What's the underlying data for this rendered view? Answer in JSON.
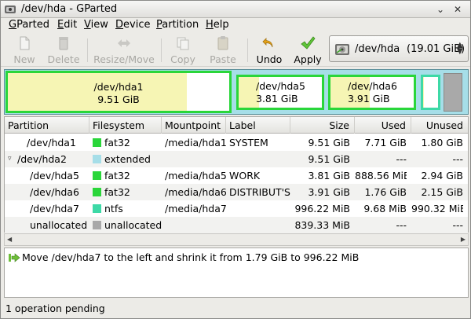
{
  "window": {
    "title": "/dev/hda - GParted",
    "minimize_icon": "chevron-down-icon",
    "close_icon": "close-icon"
  },
  "menubar": {
    "items": [
      {
        "label": "GParted",
        "mnemonic": "G"
      },
      {
        "label": "Edit",
        "mnemonic": "E"
      },
      {
        "label": "View",
        "mnemonic": "V"
      },
      {
        "label": "Device",
        "mnemonic": "D"
      },
      {
        "label": "Partition",
        "mnemonic": "P"
      },
      {
        "label": "Help",
        "mnemonic": "H"
      }
    ]
  },
  "toolbar": {
    "new_label": "New",
    "delete_label": "Delete",
    "resize_label": "Resize/Move",
    "copy_label": "Copy",
    "paste_label": "Paste",
    "undo_label": "Undo",
    "apply_label": "Apply"
  },
  "device": {
    "name": "/dev/hda",
    "size": "(19.01 GiB)"
  },
  "partition_map": [
    {
      "name": "/dev/hda1",
      "size": "9.51 GiB"
    },
    {
      "name": "/dev/hda5",
      "size": "3.81 GiB"
    },
    {
      "name": "/dev/hda6",
      "size": "3.91 GiB"
    }
  ],
  "table": {
    "columns": [
      "Partition",
      "Filesystem",
      "Mountpoint",
      "Label",
      "Size",
      "Used",
      "Unused"
    ],
    "rows": [
      {
        "partition": "/dev/hda1",
        "filesystem": "fat32",
        "mountpoint": "/media/hda1",
        "label": "SYSTEM",
        "size": "9.51 GiB",
        "used": "7.71 GiB",
        "unused": "1.80 GiB"
      },
      {
        "partition": "/dev/hda2",
        "filesystem": "extended",
        "mountpoint": "",
        "label": "",
        "size": "9.51 GiB",
        "used": "---",
        "unused": "---"
      },
      {
        "partition": "/dev/hda5",
        "filesystem": "fat32",
        "mountpoint": "/media/hda5",
        "label": "WORK",
        "size": "3.81 GiB",
        "used": "888.56 MiB",
        "unused": "2.94 GiB"
      },
      {
        "partition": "/dev/hda6",
        "filesystem": "fat32",
        "mountpoint": "/media/hda6",
        "label": "DISTRIBUT'S",
        "size": "3.91 GiB",
        "used": "1.76 GiB",
        "unused": "2.15 GiB"
      },
      {
        "partition": "/dev/hda7",
        "filesystem": "ntfs",
        "mountpoint": "/media/hda7",
        "label": "",
        "size": "996.22 MiB",
        "used": "9.68 MiB",
        "unused": "990.32 MiB"
      },
      {
        "partition": "unallocated",
        "filesystem": "unallocated",
        "mountpoint": "",
        "label": "",
        "size": "839.33 MiB",
        "used": "---",
        "unused": "---"
      }
    ]
  },
  "colors": {
    "fat32": "#2ad63a",
    "extended": "#a6dee8",
    "ntfs": "#3dd9a6",
    "unallocated": "#a9a9a9",
    "used_fill": "#f6f5b4"
  },
  "operations": {
    "items": [
      {
        "icon": "move-arrow-icon",
        "text": "Move /dev/hda7 to the left and shrink it from 1.79 GiB to 996.22 MiB"
      }
    ]
  },
  "status": {
    "text": "1 operation pending"
  }
}
